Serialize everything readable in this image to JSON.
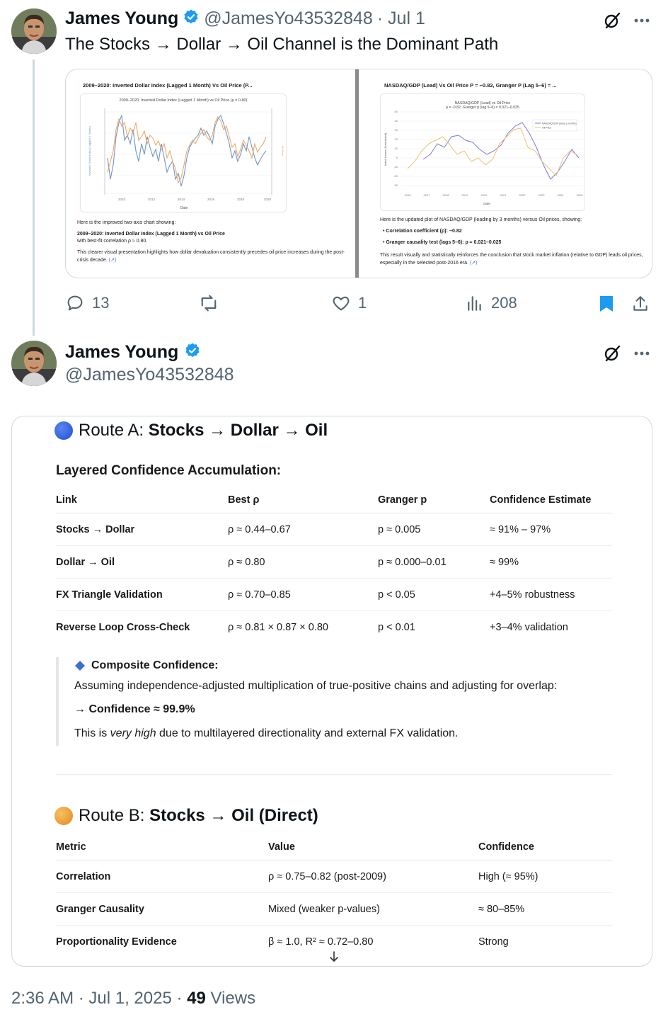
{
  "tweet1": {
    "author_name": "James Young",
    "handle": "@JamesYo43532848",
    "date": "· Jul 1",
    "text": "The Stocks → Dollar → Oil Channel is the Dominant Path",
    "media": {
      "left_panel": {
        "header": "2009–2020: Inverted Dollar Index (Lagged 1 Month) Vs Oil Price (P...",
        "chart_title": "2009–2020: Inverted Dollar Index (Lagged 1 Month) vs Oil Price (ρ = 0.80)",
        "x_label": "Date",
        "y_label_left": "Inverted Dollar Index (Lagged 1 Month)",
        "y_label_right": "Oil Price",
        "x_ticks": [
          "2010",
          "2012",
          "2014",
          "2016",
          "2018",
          "2020"
        ],
        "caption_1": "Here is the improved two-axis chart showing:",
        "caption_2": "2009–2020: Inverted Dollar Index (Lagged 1 Month) vs Oil Price",
        "caption_3": "with best-fit correlation ρ ≈ 0.80.",
        "caption_4": "This clearer visual presentation highlights how dollar devaluation consistently precedes oil price increases during the post-crisis decade.",
        "link": "(↗)"
      },
      "right_panel": {
        "header": "NASDAQ/GDP (Lead) Vs Oil Price P = −0.82, Granger P (Lag 5–6) = ...",
        "chart_title_1": "NASDAQ/GDP (Lead) vs Oil Price",
        "chart_title_2": "ρ = -0.82, Granger p (lag 5–6) = 0.021–0.025",
        "x_label": "Date",
        "y_label": "Index Levels (Normalized)",
        "legend_1": "NASDAQ/GDP (lead 3 months)",
        "legend_2": "Oil Price",
        "x_ticks": [
          "2016",
          "2017",
          "2018",
          "2019",
          "2020",
          "2021",
          "2022",
          "2023",
          "2024",
          "2025"
        ],
        "y_ticks": [
          "50",
          "40",
          "30",
          "20",
          "10",
          "0",
          "-10",
          "-20",
          "-30"
        ],
        "caption_1": "Here is the updated plot of NASDAQ/GDP (leading by 3 months) versus Oil prices, showing:",
        "bullet_1": "Correlation coefficient (ρ): −0.82",
        "bullet_2": "Granger causality test (lags 5–6): p ≈ 0.021–0.025",
        "caption_2": "This result visually and statistically reinforces the conclusion that stock market inflation (relative to GDP) leads oil prices, especially in the selected post-2016 era.",
        "link": "(↗)"
      }
    },
    "stats": {
      "replies": "13",
      "reposts": "",
      "likes": "1",
      "views": "208"
    }
  },
  "tweet2": {
    "author_name": "James Young",
    "handle": "@JamesYo43532848",
    "route_a": {
      "title_prefix": "Route A: ",
      "title_bold": "Stocks → Dollar → Oil",
      "subheading": "Layered Confidence Accumulation:",
      "columns": [
        "Link",
        "Best ρ",
        "Granger p",
        "Confidence Estimate"
      ],
      "rows": [
        [
          "Stocks → Dollar",
          "ρ ≈ 0.44–0.67",
          "p ≈ 0.005",
          "≈ 91% – 97%"
        ],
        [
          "Dollar → Oil",
          "ρ ≈ 0.80",
          "p ≈ 0.000–0.01",
          "≈ 99%"
        ],
        [
          "FX Triangle Validation",
          "ρ ≈ 0.70–0.85",
          "p < 0.05",
          "+4–5% robustness"
        ],
        [
          "Reverse Loop Cross-Check",
          "ρ ≈ 0.81 × 0.87 × 0.80",
          "p < 0.01",
          "+3–4% validation"
        ]
      ],
      "composite_label": "Composite Confidence:",
      "composite_text": "Assuming independence-adjusted multiplication of true-positive chains and adjusting for overlap:",
      "composite_result": "→ Confidence ≈ 99.9%",
      "composite_note_1": "This is ",
      "composite_note_em": "very high",
      "composite_note_2": " due to multilayered directionality and external FX validation."
    },
    "route_b": {
      "title_prefix": "Route B: ",
      "title_bold": "Stocks → Oil (Direct)",
      "columns": [
        "Metric",
        "Value",
        "Confidence"
      ],
      "rows": [
        [
          "Correlation",
          "ρ ≈ 0.75–0.82 (post-2009)",
          "High (≈ 95%)"
        ],
        [
          "Granger Causality",
          "Mixed (weaker p-values)",
          "≈ 80–85%"
        ],
        [
          "Proportionality Evidence",
          "β ≈ 1.0, R² ≈ 0.72–0.80",
          "Strong"
        ]
      ]
    },
    "timestamp": "2:36 AM · Jul 1, 2025 · ",
    "views_count": "49",
    "views_label": " Views"
  },
  "colors": {
    "accent_blue": "#1d9bf0",
    "bookmark_blue": "#1d9bf0",
    "route_a_dot": "#1f4fd1",
    "route_b_dot": "#f0a030",
    "text_secondary": "#536471"
  }
}
